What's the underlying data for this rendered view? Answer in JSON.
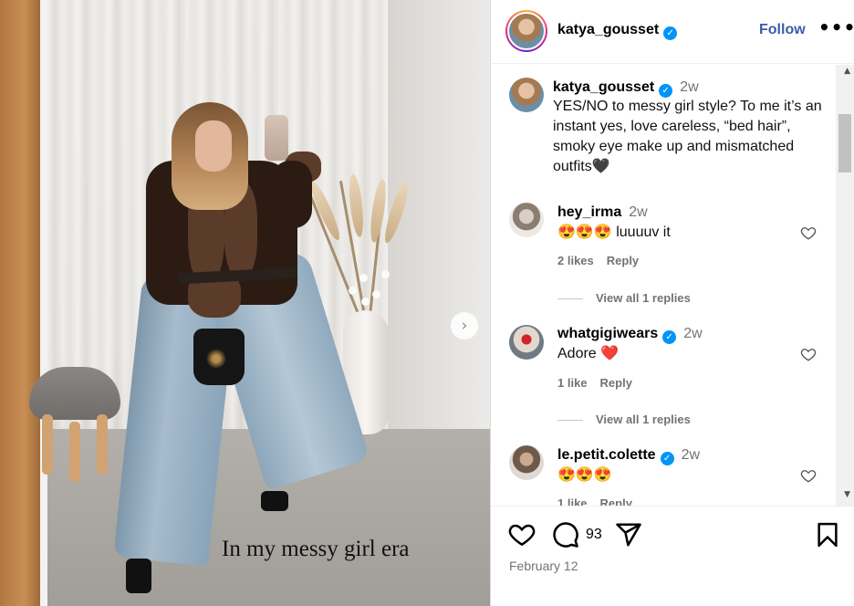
{
  "post": {
    "caption_overlay": "In my messy girl era",
    "author": "katya_gousset",
    "follow_label": "Follow",
    "more_label": "•••",
    "caption": {
      "username": "katya_gousset",
      "time": "2w",
      "text": "YES/NO to messy girl style? To me it’s an instant yes, love careless, “bed hair”, smoky eye make up and mismatched outfits🖤"
    },
    "comment_count": "93",
    "date": "February 12"
  },
  "comments": [
    {
      "username": "hey_irma",
      "time": "2w",
      "text": "😍😍😍 luuuuv it",
      "likes": "2 likes",
      "reply": "Reply",
      "replies": "View all 1 replies"
    },
    {
      "username": "whatgigiwears",
      "time": "2w",
      "text": "Adore ❤️",
      "likes": "1 like",
      "reply": "Reply",
      "replies": "View all 1 replies"
    },
    {
      "username": "le.petit.colette",
      "time": "2w",
      "text": "😍😍😍",
      "likes": "1 like",
      "reply": "Reply"
    }
  ],
  "icons": {
    "verified": "verified-badge-icon",
    "like": "heart-icon",
    "comment": "comment-icon",
    "share": "send-icon",
    "save": "bookmark-icon",
    "next": "chevron-right-icon"
  },
  "colors": {
    "follow": "#3a5ca8",
    "verified": "#0095f6",
    "meta": "#737373"
  }
}
